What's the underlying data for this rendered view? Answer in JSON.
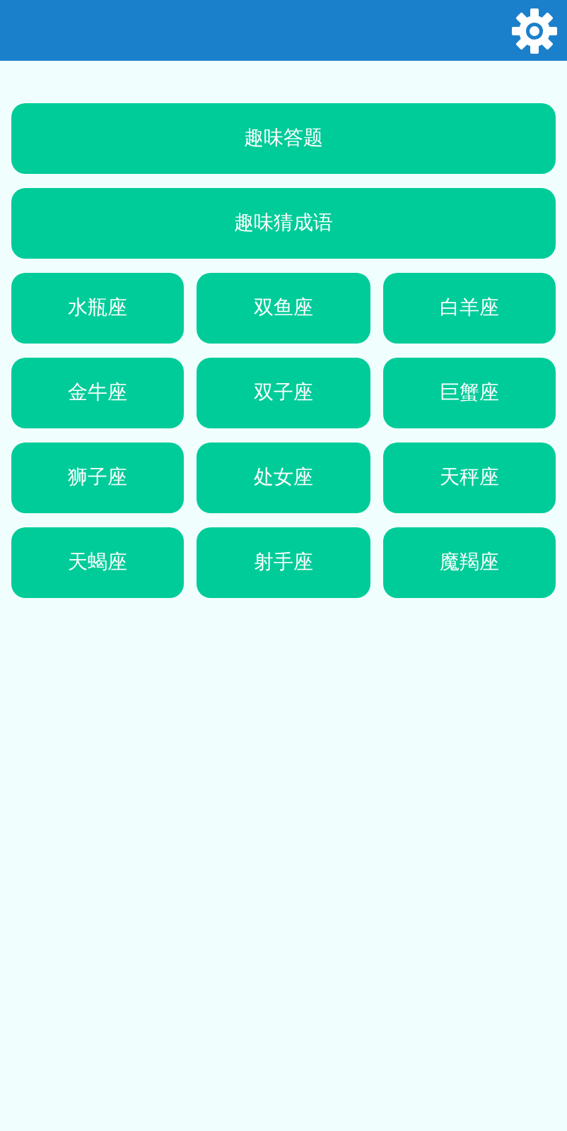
{
  "buttons": [
    {
      "label": "趣味答题",
      "kind": "wide"
    },
    {
      "label": "趣味猜成语",
      "kind": "wide"
    },
    {
      "label": "水瓶座",
      "kind": "cell"
    },
    {
      "label": "双鱼座",
      "kind": "cell"
    },
    {
      "label": "白羊座",
      "kind": "cell"
    },
    {
      "label": "金牛座",
      "kind": "cell"
    },
    {
      "label": "双子座",
      "kind": "cell"
    },
    {
      "label": "巨蟹座",
      "kind": "cell"
    },
    {
      "label": "狮子座",
      "kind": "cell"
    },
    {
      "label": "处女座",
      "kind": "cell"
    },
    {
      "label": "天秤座",
      "kind": "cell"
    },
    {
      "label": "天蝎座",
      "kind": "cell"
    },
    {
      "label": "射手座",
      "kind": "cell"
    },
    {
      "label": "魔羯座",
      "kind": "cell"
    }
  ]
}
